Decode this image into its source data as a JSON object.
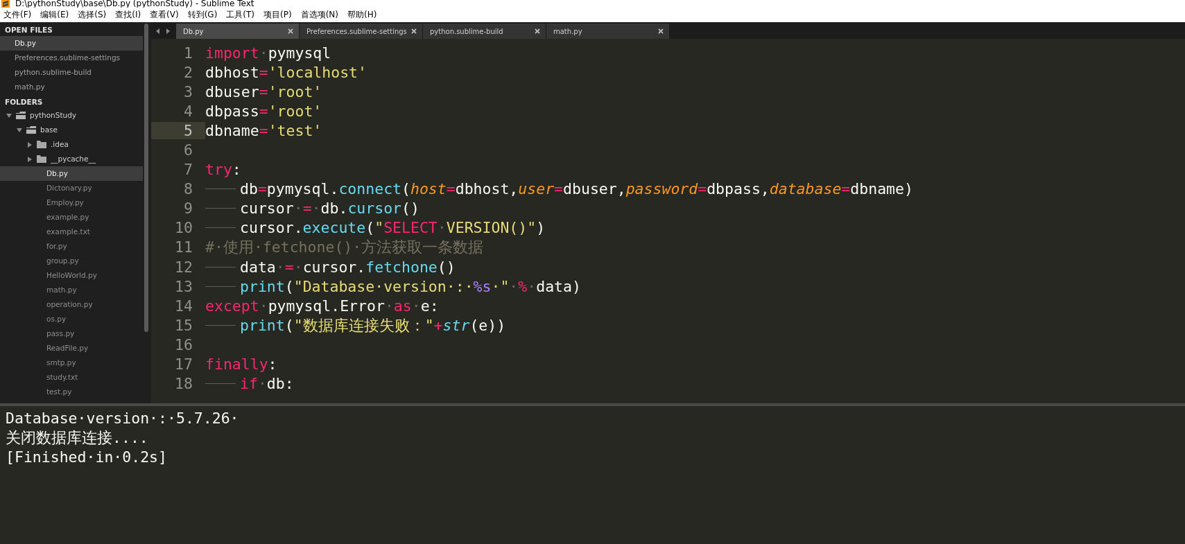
{
  "window": {
    "title": "D:\\pythonStudy\\base\\Db.py (pythonStudy) - Sublime Text"
  },
  "menu": [
    "文件(F)",
    "编辑(E)",
    "选择(S)",
    "查找(I)",
    "查看(V)",
    "转到(G)",
    "工具(T)",
    "项目(P)",
    "首选项(N)",
    "帮助(H)"
  ],
  "sidebar": {
    "open_files_heading": "OPEN FILES",
    "open_files": [
      {
        "label": "Db.py",
        "selected": true
      },
      {
        "label": "Preferences.sublime-settings",
        "selected": false
      },
      {
        "label": "python.sublime-build",
        "selected": false
      },
      {
        "label": "math.py",
        "selected": false
      }
    ],
    "folders_heading": "FOLDERS",
    "folders": [
      {
        "label": "pythonStudy",
        "kind": "folder",
        "expanded": true,
        "children": [
          {
            "label": "base",
            "kind": "folder",
            "expanded": true,
            "children": [
              {
                "label": ".idea",
                "kind": "folder",
                "expanded": false
              },
              {
                "label": "__pycache__",
                "kind": "folder",
                "expanded": false
              },
              {
                "label": "Db.py",
                "kind": "file",
                "selected": true
              },
              {
                "label": "Dictonary.py",
                "kind": "file",
                "selected": false
              },
              {
                "label": "Employ.py",
                "kind": "file",
                "selected": false
              },
              {
                "label": "example.py",
                "kind": "file",
                "selected": false
              },
              {
                "label": "example.txt",
                "kind": "file",
                "selected": false
              },
              {
                "label": "for.py",
                "kind": "file",
                "selected": false
              },
              {
                "label": "group.py",
                "kind": "file",
                "selected": false
              },
              {
                "label": "HelloWorld.py",
                "kind": "file",
                "selected": false
              },
              {
                "label": "math.py",
                "kind": "file",
                "selected": false
              },
              {
                "label": "operation.py",
                "kind": "file",
                "selected": false
              },
              {
                "label": "os.py",
                "kind": "file",
                "selected": false
              },
              {
                "label": "pass.py",
                "kind": "file",
                "selected": false
              },
              {
                "label": "ReadFile.py",
                "kind": "file",
                "selected": false
              },
              {
                "label": "smtp.py",
                "kind": "file",
                "selected": false
              },
              {
                "label": "study.txt",
                "kind": "file",
                "selected": false
              },
              {
                "label": "test.py",
                "kind": "file",
                "selected": false
              }
            ]
          }
        ]
      }
    ]
  },
  "tabs": [
    {
      "label": "Db.py",
      "selected": true
    },
    {
      "label": "Preferences.sublime-settings",
      "selected": false
    },
    {
      "label": "python.sublime-build",
      "selected": false
    },
    {
      "label": "math.py",
      "selected": false
    }
  ],
  "editor": {
    "lines": [
      {
        "number": "1",
        "current": false,
        "indented": false,
        "tokens": [
          {
            "kind": "keyword",
            "text": "import"
          },
          {
            "kind": "space",
            "text": "·"
          },
          {
            "kind": "plain",
            "text": "pymysql"
          }
        ]
      },
      {
        "number": "2",
        "current": false,
        "indented": false,
        "tokens": [
          {
            "kind": "plain",
            "text": "dbhost"
          },
          {
            "kind": "keyword",
            "text": "="
          },
          {
            "kind": "string",
            "text": "'localhost'"
          }
        ]
      },
      {
        "number": "3",
        "current": false,
        "indented": false,
        "tokens": [
          {
            "kind": "plain",
            "text": "dbuser"
          },
          {
            "kind": "keyword",
            "text": "="
          },
          {
            "kind": "string",
            "text": "'root'"
          }
        ]
      },
      {
        "number": "4",
        "current": false,
        "indented": false,
        "tokens": [
          {
            "kind": "plain",
            "text": "dbpass"
          },
          {
            "kind": "keyword",
            "text": "="
          },
          {
            "kind": "string",
            "text": "'root'"
          }
        ]
      },
      {
        "number": "5",
        "current": true,
        "indented": false,
        "tokens": [
          {
            "kind": "plain",
            "text": "dbname"
          },
          {
            "kind": "keyword",
            "text": "="
          },
          {
            "kind": "string",
            "text": "'test'"
          }
        ]
      },
      {
        "number": "6",
        "current": false,
        "indented": false
      },
      {
        "number": "7",
        "current": false,
        "indented": false,
        "tokens": [
          {
            "kind": "keyword",
            "text": "try"
          },
          {
            "kind": "plain",
            "text": ":"
          }
        ]
      },
      {
        "number": "8",
        "current": false,
        "indented": true,
        "tokens": [
          {
            "kind": "plain",
            "text": "db"
          },
          {
            "kind": "keyword",
            "text": "="
          },
          {
            "kind": "plain",
            "text": "pymysql."
          },
          {
            "kind": "function",
            "text": "connect"
          },
          {
            "kind": "plain",
            "text": "("
          },
          {
            "kind": "param",
            "text": "host"
          },
          {
            "kind": "keyword",
            "text": "="
          },
          {
            "kind": "plain",
            "text": "dbhost,"
          },
          {
            "kind": "param",
            "text": "user"
          },
          {
            "kind": "keyword",
            "text": "="
          },
          {
            "kind": "plain",
            "text": "dbuser,"
          },
          {
            "kind": "param",
            "text": "password"
          },
          {
            "kind": "keyword",
            "text": "="
          },
          {
            "kind": "plain",
            "text": "dbpass,"
          },
          {
            "kind": "param",
            "text": "database"
          },
          {
            "kind": "keyword",
            "text": "="
          },
          {
            "kind": "plain",
            "text": "dbname)"
          }
        ]
      },
      {
        "number": "9",
        "current": false,
        "indented": true,
        "tokens": [
          {
            "kind": "plain",
            "text": "cursor"
          },
          {
            "kind": "space",
            "text": "·"
          },
          {
            "kind": "keyword",
            "text": "="
          },
          {
            "kind": "space",
            "text": "·"
          },
          {
            "kind": "plain",
            "text": "db."
          },
          {
            "kind": "function",
            "text": "cursor"
          },
          {
            "kind": "plain",
            "text": "()"
          }
        ]
      },
      {
        "number": "10",
        "current": false,
        "indented": true,
        "tokens": [
          {
            "kind": "plain",
            "text": "cursor."
          },
          {
            "kind": "function",
            "text": "execute"
          },
          {
            "kind": "plain",
            "text": "("
          },
          {
            "kind": "string",
            "text": "\""
          },
          {
            "kind": "keyword",
            "text": "SELECT"
          },
          {
            "kind": "space",
            "text": "·"
          },
          {
            "kind": "string",
            "text": "VERSION()\""
          },
          {
            "kind": "plain",
            "text": ")"
          }
        ]
      },
      {
        "number": "11",
        "current": false,
        "indented": false,
        "tokens": [
          {
            "kind": "comment",
            "text": "#·使用·fetchone()·方法获取一条数据"
          }
        ]
      },
      {
        "number": "12",
        "current": false,
        "indented": true,
        "tokens": [
          {
            "kind": "plain",
            "text": "data"
          },
          {
            "kind": "space",
            "text": "·"
          },
          {
            "kind": "keyword",
            "text": "="
          },
          {
            "kind": "space",
            "text": "·"
          },
          {
            "kind": "plain",
            "text": "cursor."
          },
          {
            "kind": "function",
            "text": "fetchone"
          },
          {
            "kind": "plain",
            "text": "()"
          }
        ]
      },
      {
        "number": "13",
        "current": false,
        "indented": true,
        "tokens": [
          {
            "kind": "function",
            "text": "print"
          },
          {
            "kind": "plain",
            "text": "("
          },
          {
            "kind": "string",
            "text": "\"Database·version·:·"
          },
          {
            "kind": "format",
            "text": "%s"
          },
          {
            "kind": "string",
            "text": "·\""
          },
          {
            "kind": "space",
            "text": "·"
          },
          {
            "kind": "keyword",
            "text": "%"
          },
          {
            "kind": "space",
            "text": "·"
          },
          {
            "kind": "plain",
            "text": "data)"
          }
        ]
      },
      {
        "number": "14",
        "current": false,
        "indented": false,
        "tokens": [
          {
            "kind": "keyword",
            "text": "except"
          },
          {
            "kind": "space",
            "text": "·"
          },
          {
            "kind": "plain",
            "text": "pymysql.Error"
          },
          {
            "kind": "space",
            "text": "·"
          },
          {
            "kind": "keyword",
            "text": "as"
          },
          {
            "kind": "space",
            "text": "·"
          },
          {
            "kind": "plain",
            "text": "e:"
          }
        ]
      },
      {
        "number": "15",
        "current": false,
        "indented": true,
        "tokens": [
          {
            "kind": "function",
            "text": "print"
          },
          {
            "kind": "plain",
            "text": "("
          },
          {
            "kind": "string",
            "text": "\"数据库连接失败：\""
          },
          {
            "kind": "keyword",
            "text": "+"
          },
          {
            "kind": "builtin",
            "text": "str"
          },
          {
            "kind": "plain",
            "text": "(e))"
          }
        ]
      },
      {
        "number": "16",
        "current": false,
        "indented": false
      },
      {
        "number": "17",
        "current": false,
        "indented": false,
        "tokens": [
          {
            "kind": "keyword",
            "text": "finally"
          },
          {
            "kind": "plain",
            "text": ":"
          }
        ]
      },
      {
        "number": "18",
        "current": false,
        "indented": true,
        "tokens": [
          {
            "kind": "keyword",
            "text": "if"
          },
          {
            "kind": "space",
            "text": "·"
          },
          {
            "kind": "plain",
            "text": "db:"
          }
        ]
      }
    ]
  },
  "output": {
    "lines": [
      "Database·version·:·5.7.26·",
      "关闭数据库连接....",
      "[Finished·in·0.2s]"
    ]
  }
}
